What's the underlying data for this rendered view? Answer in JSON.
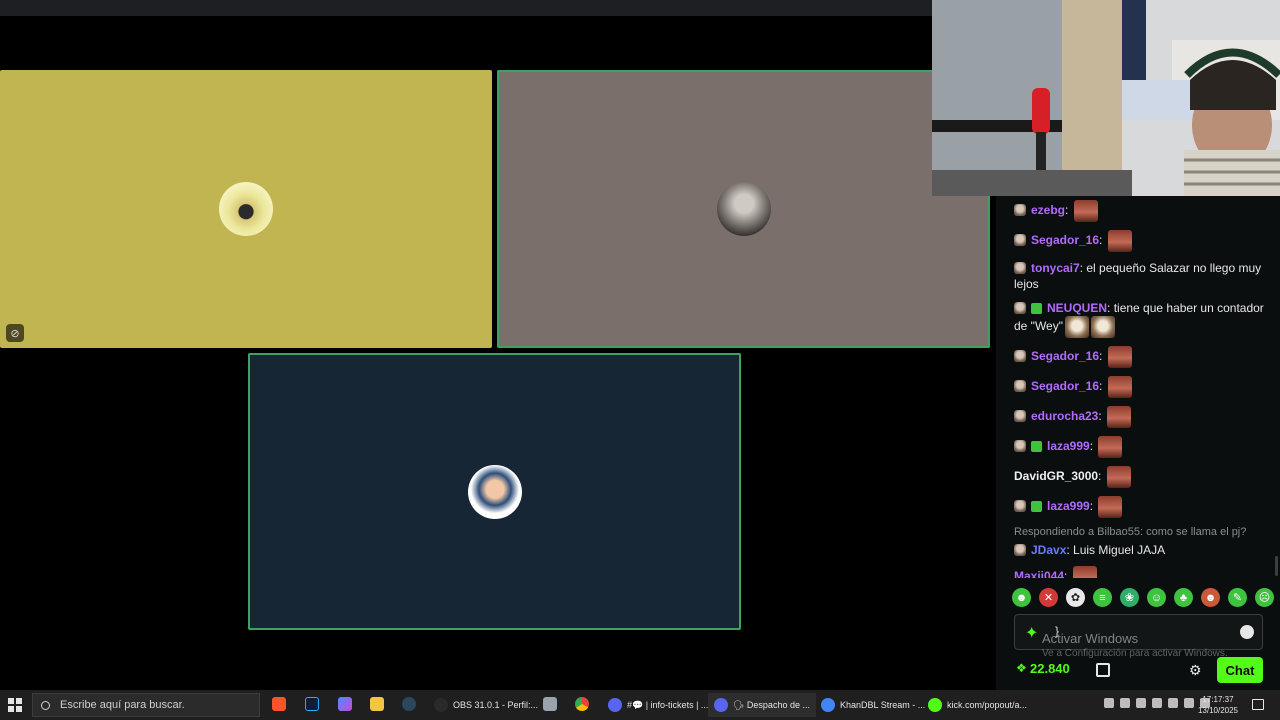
{
  "chat": {
    "messages": [
      {
        "user": "ezebg",
        "color": "#b26bff",
        "text": "",
        "mod": true,
        "sub": false,
        "emotes": 1
      },
      {
        "user": "Segador_16",
        "color": "#b26bff",
        "text": "",
        "mod": true,
        "sub": false,
        "emotes": 1
      },
      {
        "user": "tonycai7",
        "color": "#b26bff",
        "text": "el pequeño Salazar no llego muy lejos",
        "mod": true,
        "sub": false,
        "emotes": 0
      },
      {
        "user": "NEUQUEN",
        "color": "#b26bff",
        "text": "tiene que haber un contador de \"Wey\"",
        "mod": true,
        "sub": true,
        "emotes": 2,
        "emote_type": "cat"
      },
      {
        "user": "Segador_16",
        "color": "#b26bff",
        "text": "",
        "mod": true,
        "sub": false,
        "emotes": 1
      },
      {
        "user": "Segador_16",
        "color": "#b26bff",
        "text": "",
        "mod": true,
        "sub": false,
        "emotes": 1
      },
      {
        "user": "edurocha23",
        "color": "#b26bff",
        "text": "",
        "mod": true,
        "sub": false,
        "emotes": 1
      },
      {
        "user": "laza999",
        "color": "#b26bff",
        "text": "",
        "mod": true,
        "sub": true,
        "emotes": 1
      },
      {
        "user": "DavidGR_3000",
        "color": "#f0f0f0",
        "text": "",
        "mod": false,
        "sub": false,
        "emotes": 1
      },
      {
        "user": "laza999",
        "color": "#b26bff",
        "text": "",
        "mod": true,
        "sub": true,
        "emotes": 1
      },
      {
        "reply_to": "Respondiendo a Bilbao55: como se llama el pj?",
        "user": "JDavx",
        "color": "#6b7bff",
        "text": "Luis Miguel JAJA",
        "mod": true,
        "sub": false,
        "emotes": 0
      },
      {
        "user": "Maxii044",
        "color": "#b26bff",
        "text": "",
        "mod": false,
        "sub": false,
        "emotes": 1
      },
      {
        "user": "Maxii044",
        "color": "#b26bff",
        "text": "",
        "mod": false,
        "sub": false,
        "emotes": 1
      }
    ],
    "input_value": "}",
    "watermark_title": "Activar Windows",
    "watermark_sub": "Ve a Configuración para activar Windows.",
    "points": "22.840",
    "chat_button": "Chat"
  },
  "taskbar": {
    "search_placeholder": "Escribe aquí para buscar.",
    "tasks": [
      {
        "label": "OBS 31.0.1 - Perfil:...",
        "icon_color": "#2a2a2a",
        "active": false
      },
      {
        "label": "#💬 | info-tickets | ...",
        "icon_color": "#5865f2",
        "active": false
      },
      {
        "label": "🗣 Despacho de ...",
        "icon_color": "#5865f2",
        "active": true
      },
      {
        "label": "KhanDBL Stream - ...",
        "icon_color": "#4285f4",
        "active": false
      },
      {
        "label": "kick.com/popout/a...",
        "icon_color": "#53fc18",
        "active": false
      }
    ],
    "time": "17:17:37",
    "date": "13/10/2025"
  },
  "colors": {
    "accent": "#53fc18",
    "tile_yellow": "#c0b550",
    "tile_taupe": "#7b6f6b",
    "tile_navy": "#172634"
  }
}
